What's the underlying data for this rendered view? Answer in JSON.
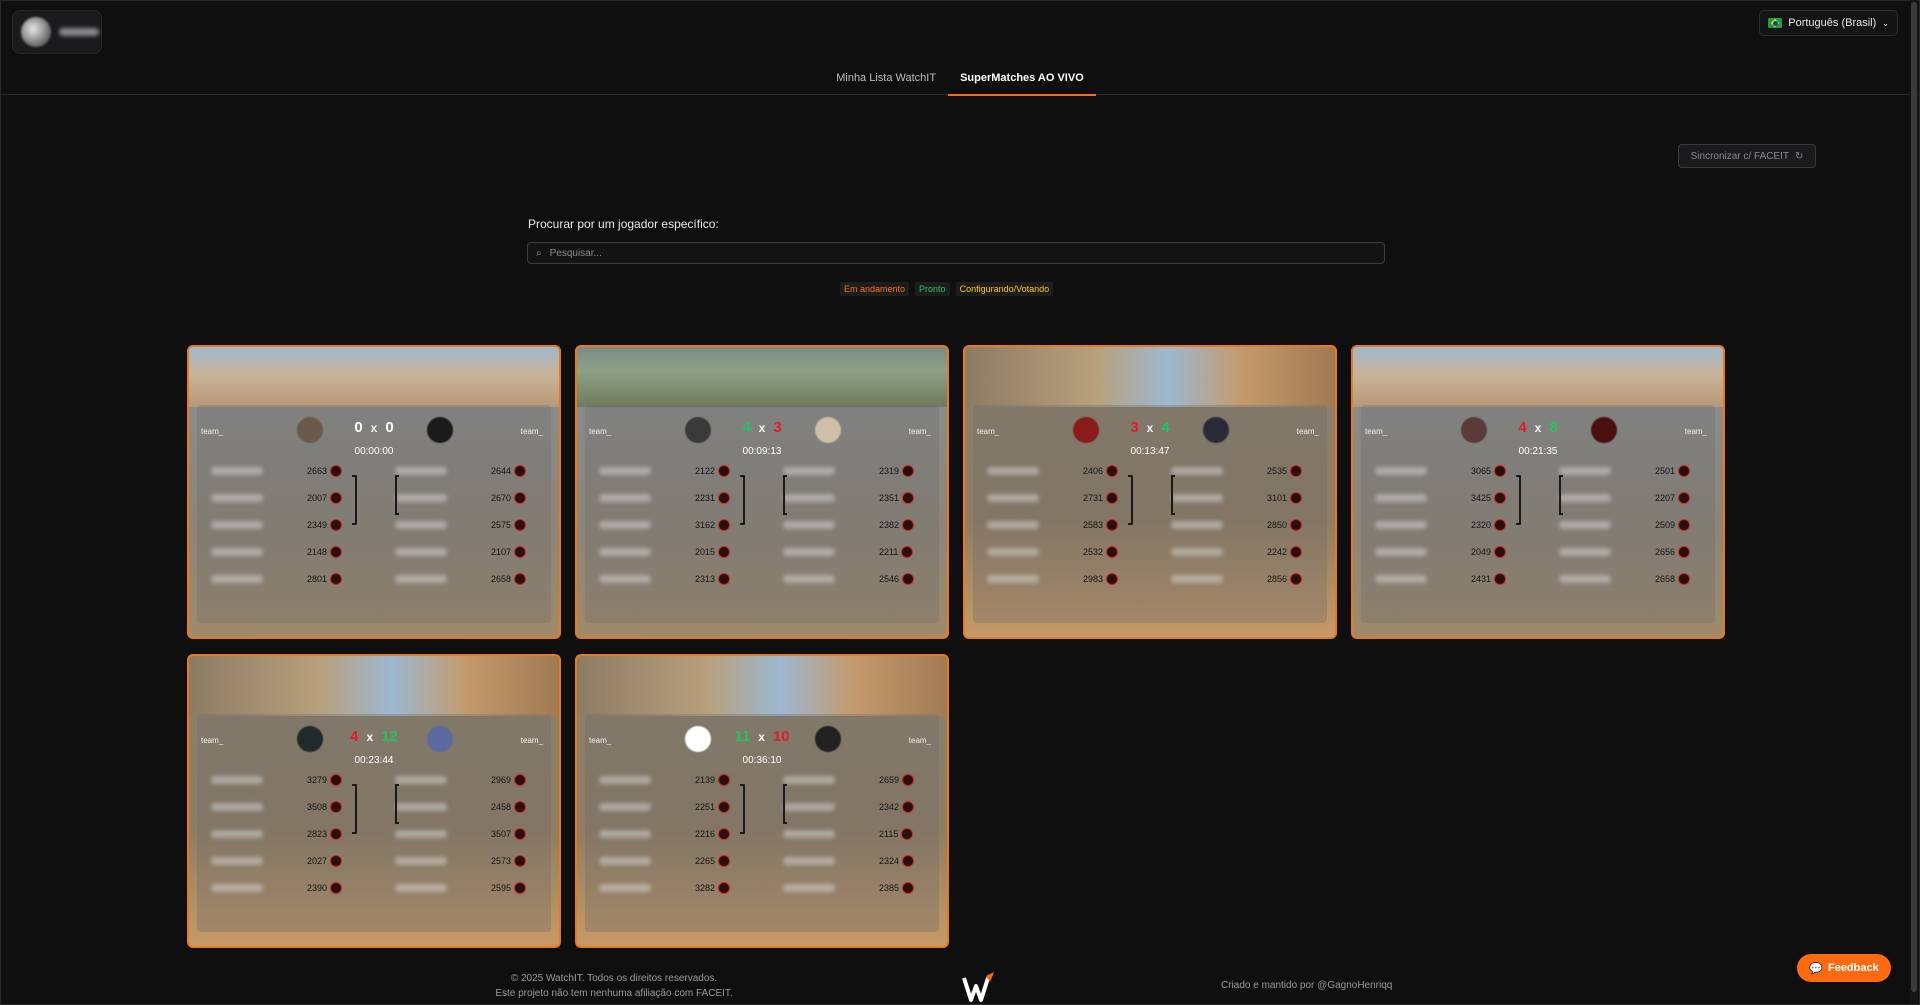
{
  "header": {
    "language": "Português (Brasil)"
  },
  "nav": {
    "tabs": [
      "Minha Lista WatchIT",
      "SuperMatches AO VIVO"
    ],
    "active": 1
  },
  "sync_button": "Sincronizar c/ FACEIT",
  "search": {
    "label": "Procurar por um jogador específico:",
    "placeholder": "Pesquisar..."
  },
  "legend": [
    {
      "label": "Em andamento",
      "color": "#f97316"
    },
    {
      "label": "Pronto",
      "color": "#22c55e"
    },
    {
      "label": "Configurando/Votando",
      "color": "#facc15"
    }
  ],
  "matches": [
    {
      "map": "dust",
      "team_left": "team_",
      "team_right": "team_",
      "score_left": "0",
      "score_right": "0",
      "score_left_color": "w",
      "score_right_color": "w",
      "time": "00:00:00",
      "left_elos": [
        "2663",
        "2007",
        "2349",
        "2148",
        "2801"
      ],
      "right_elos": [
        "2644",
        "2670",
        "2575",
        "2107",
        "2658"
      ]
    },
    {
      "map": "ancient",
      "team_left": "team_",
      "team_right": "team_",
      "score_left": "4",
      "score_right": "3",
      "score_left_color": "g",
      "score_right_color": "r",
      "time": "00:09:13",
      "left_elos": [
        "2122",
        "2231",
        "3162",
        "2015",
        "2313"
      ],
      "right_elos": [
        "2319",
        "2351",
        "2382",
        "2211",
        "2546"
      ],
      "right_names": [
        "",
        "fla",
        "",
        "",
        ""
      ]
    },
    {
      "map": "mirage",
      "team_left": "team_",
      "team_right": "team_",
      "score_left": "3",
      "score_right": "4",
      "score_left_color": "r",
      "score_right_color": "g",
      "time": "00:13:47",
      "left_elos": [
        "2406",
        "2731",
        "2583",
        "2532",
        "2983"
      ],
      "right_elos": [
        "2535",
        "3101",
        "2850",
        "2242",
        "2856"
      ]
    },
    {
      "map": "dust",
      "team_left": "team_",
      "team_right": "team_",
      "score_left": "4",
      "score_right": "8",
      "score_left_color": "r",
      "score_right_color": "g",
      "time": "00:21:35",
      "left_elos": [
        "3065",
        "3425",
        "2320",
        "2049",
        "2431"
      ],
      "right_elos": [
        "2501",
        "2207",
        "2509",
        "2656",
        "2658"
      ]
    },
    {
      "map": "mirage",
      "team_left": "team_",
      "team_right": "team_",
      "score_left": "4",
      "score_right": "12",
      "score_left_color": "r",
      "score_right_color": "g",
      "time": "00:23:44",
      "left_elos": [
        "3279",
        "3508",
        "2823",
        "2027",
        "2390"
      ],
      "right_elos": [
        "2969",
        "2458",
        "3507",
        "2573",
        "2595"
      ]
    },
    {
      "map": "mirage",
      "team_left": "team_",
      "team_right": "team_",
      "score_left": "11",
      "score_right": "10",
      "score_left_color": "g",
      "score_right_color": "r",
      "time": "00:36:10",
      "left_elos": [
        "2139",
        "2251",
        "2216",
        "2265",
        "3282"
      ],
      "right_elos": [
        "2659",
        "2342",
        "2115",
        "2324",
        "2385"
      ]
    }
  ],
  "footer": {
    "copyright": "© 2025 WatchIT. Todos os direitos reservados.",
    "disclaimer": "Este projeto não tem nenhuma afiliação com FACEIT.",
    "credit": "Criado e mantido por @GagnoHenriqq"
  },
  "feedback_button": "Feedback",
  "colors": {
    "accent": "#ff6a10",
    "background": "#0f0f10",
    "win": "#22c55e",
    "lose": "#e11d2a"
  }
}
